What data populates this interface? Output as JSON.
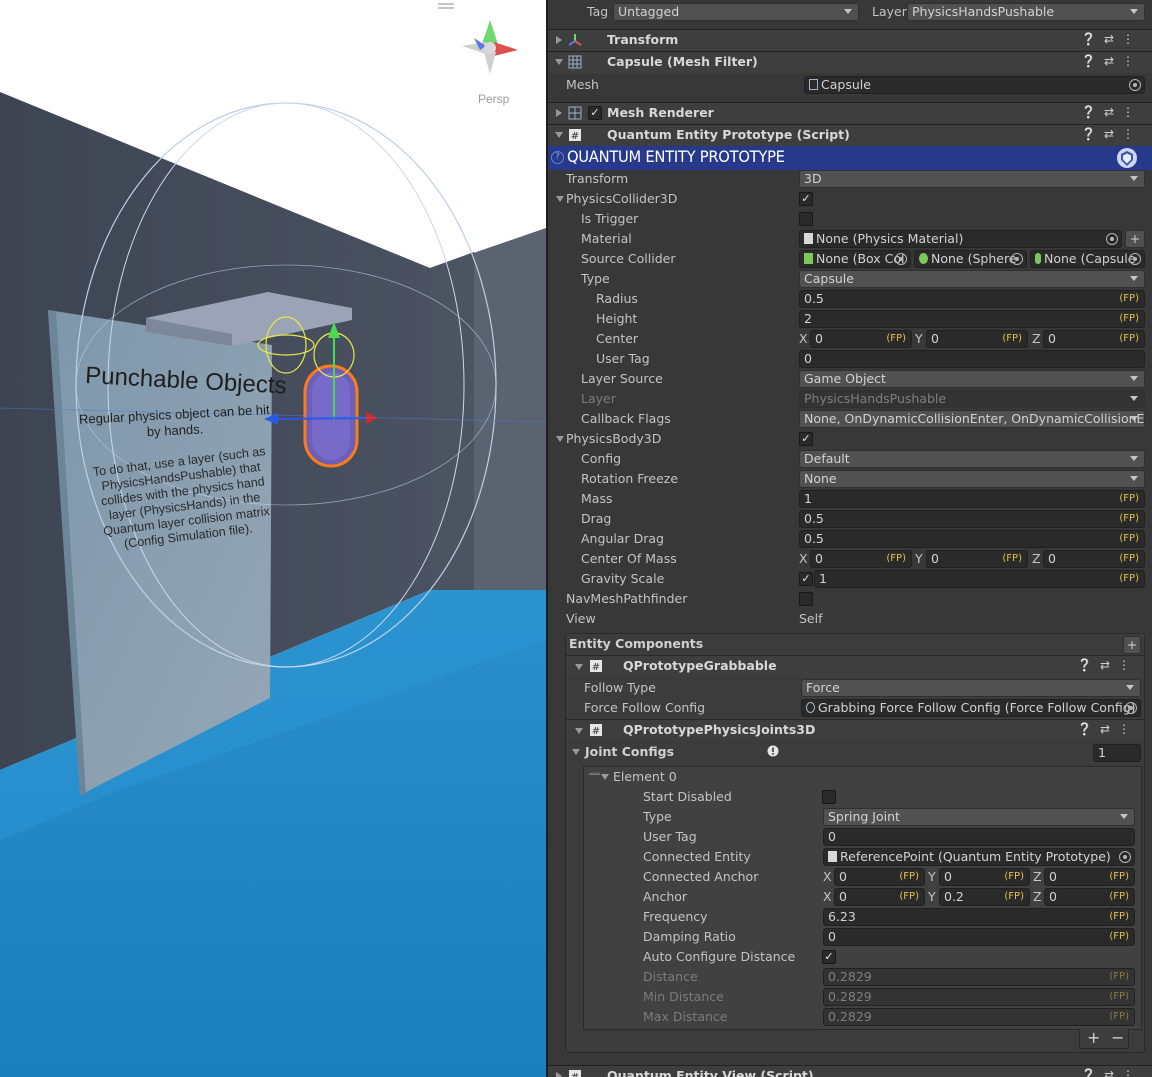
{
  "scene": {
    "persp_label": "Persp",
    "sign_title": "Punchable Objects",
    "sign_subtitle": "Regular physics object can be hit by hands.",
    "sign_body": "To do that, use a layer (such as PhysicsHandsPushable) that collides with the physics hand layer (PhysicsHands) in the Quantum layer collision matrix (Config Simulation file)."
  },
  "top_bar": {
    "tag_label": "Tag",
    "tag_value": "Untagged",
    "layer_label": "Layer",
    "layer_value": "PhysicsHandsPushable"
  },
  "components": {
    "transform": "Transform",
    "mesh_filter": "Capsule (Mesh Filter)",
    "mesh_label": "Mesh",
    "mesh_value": "Capsule",
    "mesh_renderer": "Mesh Renderer",
    "entity_prototype": "Quantum Entity Prototype (Script)",
    "entity_view": "Quantum Entity View (Script)"
  },
  "banner": {
    "title": "QUANTUM ENTITY PROTOTYPE"
  },
  "fp_tag": "(FP)",
  "axes": {
    "x": "X",
    "y": "Y",
    "z": "Z"
  },
  "props": {
    "transform_label": "Transform",
    "transform_value": "3D",
    "collider_label": "PhysicsCollider3D",
    "is_trigger": "Is Trigger",
    "material_label": "Material",
    "material_value": "None (Physics Material)",
    "source_collider_label": "Source Collider",
    "source_box": "None (Box Col",
    "source_sphere": "None (Sphere",
    "source_capsule": "None (Capsule",
    "type_label": "Type",
    "type_value": "Capsule",
    "radius_label": "Radius",
    "radius_value": "0.5",
    "height_label": "Height",
    "height_value": "2",
    "center_label": "Center",
    "center_x": "0",
    "center_y": "0",
    "center_z": "0",
    "usertag_label": "User Tag",
    "usertag_value": "0",
    "layersource_label": "Layer Source",
    "layersource_value": "Game Object",
    "layer_label": "Layer",
    "layer_value": "PhysicsHandsPushable",
    "callback_label": "Callback Flags",
    "callback_value": "None, OnDynamicCollisionEnter, OnDynamicCollisionExit, O",
    "body_label": "PhysicsBody3D",
    "config_label": "Config",
    "config_value": "Default",
    "rotfreeze_label": "Rotation Freeze",
    "rotfreeze_value": "None",
    "mass_label": "Mass",
    "mass_value": "1",
    "drag_label": "Drag",
    "drag_value": "0.5",
    "angdrag_label": "Angular Drag",
    "angdrag_value": "0.5",
    "com_label": "Center Of Mass",
    "com_x": "0",
    "com_y": "0",
    "com_z": "0",
    "gravity_label": "Gravity Scale",
    "gravity_value": "1",
    "navmesh_label": "NavMeshPathfinder",
    "view_label": "View",
    "view_value": "Self"
  },
  "entity_components": {
    "title": "Entity Components",
    "grabbable": {
      "title": "QPrototypeGrabbable",
      "follow_type_label": "Follow Type",
      "follow_type_value": "Force",
      "force_cfg_label": "Force Follow Config",
      "force_cfg_value": "Grabbing Force Follow Config (Force Follow Config)"
    },
    "joints": {
      "title": "QPrototypePhysicsJoints3D",
      "joint_configs_label": "Joint Configs",
      "joint_configs_count": "1",
      "element_label": "Element 0",
      "start_disabled": "Start Disabled",
      "type_label": "Type",
      "type_value": "Spring Joint",
      "usertag_label": "User Tag",
      "usertag_value": "0",
      "connected_entity_label": "Connected Entity",
      "connected_entity_value": "ReferencePoint (Quantum Entity Prototype)",
      "connected_anchor_label": "Connected Anchor",
      "ca_x": "0",
      "ca_y": "0",
      "ca_z": "0",
      "anchor_label": "Anchor",
      "a_x": "0",
      "a_y": "0.2",
      "a_z": "0",
      "frequency_label": "Frequency",
      "frequency_value": "6.23",
      "damping_label": "Damping Ratio",
      "damping_value": "0",
      "auto_cfg_label": "Auto Configure Distance",
      "distance_label": "Distance",
      "distance_value": "0.2829",
      "min_distance_label": "Min Distance",
      "min_distance_value": "0.2829",
      "max_distance_label": "Max Distance",
      "max_distance_value": "0.2829",
      "add_label": "+",
      "remove_label": "−"
    }
  },
  "colors": {
    "banner": "#26398a",
    "fp_tag": "#e3c04a",
    "selection_outline": "#ff7a1a",
    "floor": "#1a8ed0"
  }
}
